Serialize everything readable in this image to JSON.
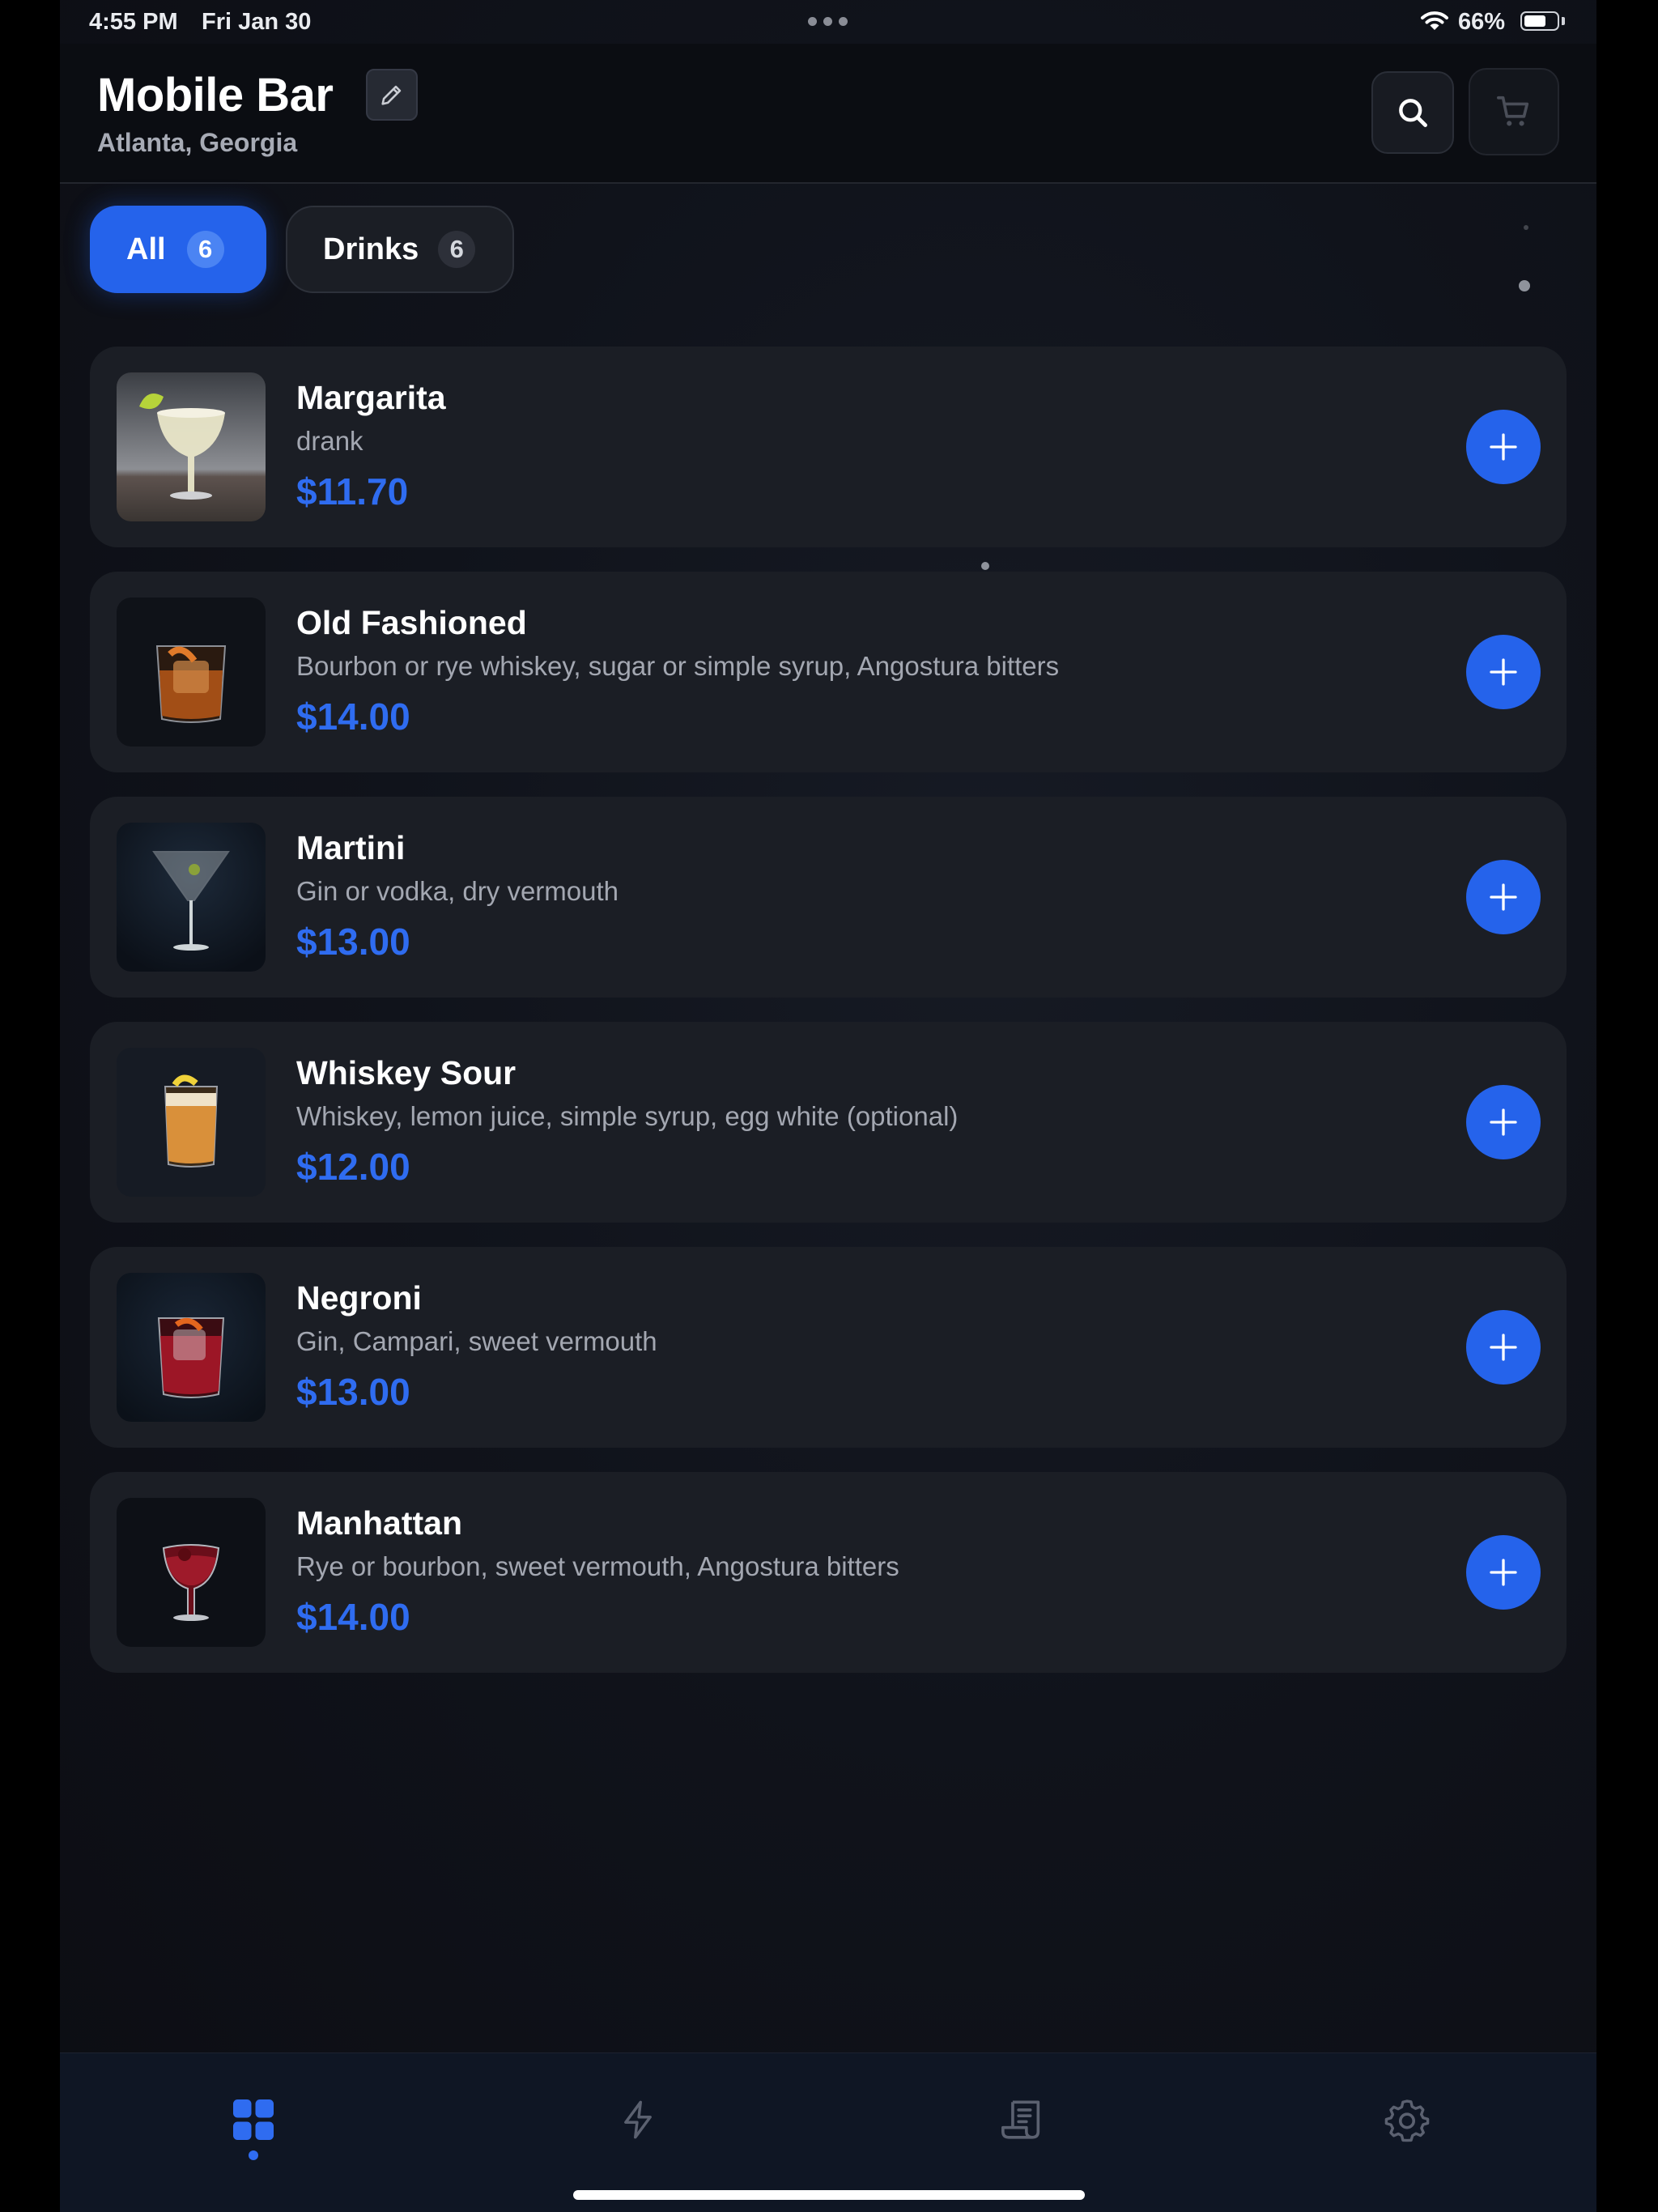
{
  "status_bar": {
    "time": "4:55 PM",
    "date": "Fri Jan 30",
    "battery": "66%",
    "battery_level": 0.66
  },
  "header": {
    "title": "Mobile Bar",
    "subtitle": "Atlanta, Georgia",
    "icons": {
      "edit": "pencil-icon",
      "search": "search-icon",
      "cart": "cart-icon"
    }
  },
  "filters": [
    {
      "label": "All",
      "count": "6",
      "selected": true
    },
    {
      "label": "Drinks",
      "count": "6",
      "selected": false
    }
  ],
  "items": [
    {
      "name": "Margarita",
      "description": "drank",
      "price": "$11.70",
      "image": "margarita-photo"
    },
    {
      "name": "Old Fashioned",
      "description": "Bourbon or rye whiskey, sugar or simple syrup, Angostura bitters",
      "price": "$14.00",
      "image": "old-fashioned-photo"
    },
    {
      "name": "Martini",
      "description": "Gin or vodka, dry vermouth",
      "price": "$13.00",
      "image": "martini-photo"
    },
    {
      "name": "Whiskey Sour",
      "description": "Whiskey, lemon juice, simple syrup, egg white (optional)",
      "price": "$12.00",
      "image": "whiskey-sour-photo"
    },
    {
      "name": "Negroni",
      "description": "Gin, Campari, sweet vermouth",
      "price": "$13.00",
      "image": "negroni-photo"
    },
    {
      "name": "Manhattan",
      "description": "Rye or bourbon, sweet vermouth, Angostura bitters",
      "price": "$14.00",
      "image": "manhattan-photo"
    }
  ],
  "tab_bar": [
    {
      "icon": "grid-icon",
      "active": true
    },
    {
      "icon": "lightning-icon",
      "active": false
    },
    {
      "icon": "receipt-icon",
      "active": false
    },
    {
      "icon": "gear-icon",
      "active": false
    }
  ],
  "colors": {
    "accent": "#2563eb",
    "price": "#2f6cf0",
    "background": "#10131b",
    "card": "#1b1e25"
  }
}
